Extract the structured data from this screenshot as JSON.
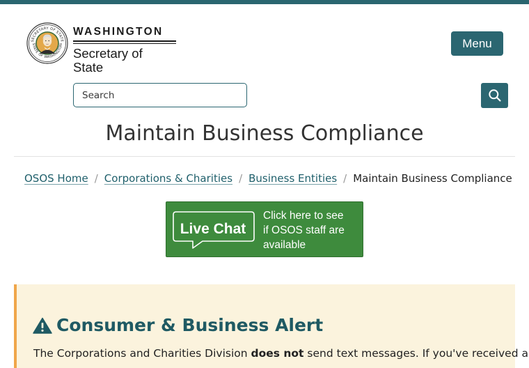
{
  "colors": {
    "brand_teal": "#2b6671",
    "top_bar": "#2a6670",
    "live_chat_green": "#3e8b3d",
    "alert_background": "#fbf3dd",
    "alert_border": "#f0a64a",
    "alert_title": "#1f5a63"
  },
  "header": {
    "seal_icon": "washington-state-seal",
    "logo_line1": "WASHINGTON",
    "logo_line2": "Secretary of State",
    "menu_label": "Menu"
  },
  "search": {
    "placeholder": "Search",
    "button_icon": "search-icon"
  },
  "page": {
    "title": "Maintain Business Compliance"
  },
  "breadcrumb": {
    "items": [
      {
        "label": "OSOS Home",
        "link": true
      },
      {
        "label": "Corporations & Charities",
        "link": true
      },
      {
        "label": "Business Entities",
        "link": true
      },
      {
        "label": "Maintain Business Compliance",
        "link": false
      }
    ],
    "separator": "/"
  },
  "live_chat": {
    "label": "Live Chat",
    "line1": "Click here to see",
    "line2": "if OSOS staff are",
    "line3": "available"
  },
  "alert": {
    "icon": "warning-icon",
    "title": "Consumer & Business Alert",
    "text_before": "The Corporations and Charities Division ",
    "text_bold": "does not",
    "text_after": " send text messages. If you've received a"
  }
}
